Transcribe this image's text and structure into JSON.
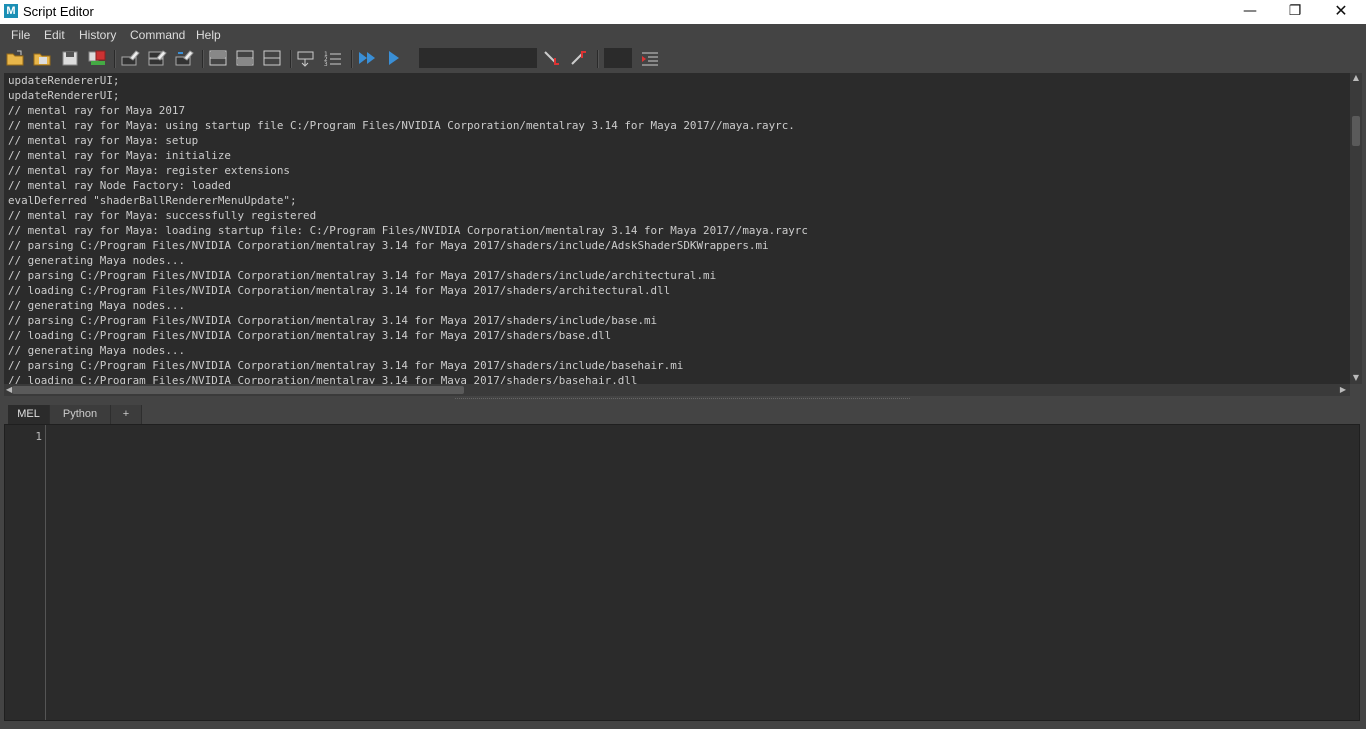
{
  "window": {
    "title": "Script Editor",
    "app_icon_letter": "M",
    "minimize_glyph": "—",
    "maximize_glyph": "❐",
    "close_glyph": "✕"
  },
  "menu": {
    "items": [
      {
        "label": "File"
      },
      {
        "label": "Edit"
      },
      {
        "label": "History"
      },
      {
        "label": "Command"
      },
      {
        "label": "Help"
      }
    ]
  },
  "toolbar": {
    "icons": [
      "open-script-icon",
      "source-script-icon",
      "save-script-icon",
      "save-to-shelf-icon",
      "clear-history-icon",
      "clear-input-icon",
      "clear-all-icon",
      "show-history-only-icon",
      "show-input-only-icon",
      "show-both-icon",
      "echo-all-commands-icon",
      "show-line-numbers-icon",
      "execute-all-icon",
      "execute-icon",
      "search-field",
      "search-down-icon",
      "search-up-icon",
      "goto-line-field",
      "indent-icon"
    ]
  },
  "output": {
    "lines": [
      "updateRendererUI;",
      "updateRendererUI;",
      "// mental ray for Maya 2017",
      "// mental ray for Maya: using startup file C:/Program Files/NVIDIA Corporation/mentalray 3.14 for Maya 2017//maya.rayrc.",
      "// mental ray for Maya: setup",
      "// mental ray for Maya: initialize",
      "// mental ray for Maya: register extensions",
      "// mental ray Node Factory: loaded",
      "evalDeferred \"shaderBallRendererMenuUpdate\";",
      "// mental ray for Maya: successfully registered",
      "// mental ray for Maya: loading startup file: C:/Program Files/NVIDIA Corporation/mentalray 3.14 for Maya 2017//maya.rayrc",
      "// parsing C:/Program Files/NVIDIA Corporation/mentalray 3.14 for Maya 2017/shaders/include/AdskShaderSDKWrappers.mi",
      "// generating Maya nodes...",
      "// parsing C:/Program Files/NVIDIA Corporation/mentalray 3.14 for Maya 2017/shaders/include/architectural.mi",
      "// loading C:/Program Files/NVIDIA Corporation/mentalray 3.14 for Maya 2017/shaders/architectural.dll",
      "// generating Maya nodes...",
      "// parsing C:/Program Files/NVIDIA Corporation/mentalray 3.14 for Maya 2017/shaders/include/base.mi",
      "// loading C:/Program Files/NVIDIA Corporation/mentalray 3.14 for Maya 2017/shaders/base.dll",
      "// generating Maya nodes...",
      "// parsing C:/Program Files/NVIDIA Corporation/mentalray 3.14 for Maya 2017/shaders/include/basehair.mi",
      "// loading C:/Program Files/NVIDIA Corporation/mentalray 3.14 for Maya 2017/shaders/basehair.dll"
    ]
  },
  "tabs": [
    {
      "label": "MEL",
      "active": true
    },
    {
      "label": "Python",
      "active": false
    },
    {
      "label": "+",
      "active": false
    }
  ],
  "editor": {
    "line_numbers": [
      "1"
    ],
    "content": ""
  },
  "colors": {
    "panel": "#444444",
    "editor_bg": "#2b2b2b",
    "text": "#cccccc",
    "accent_blue": "#3a8fd6"
  }
}
